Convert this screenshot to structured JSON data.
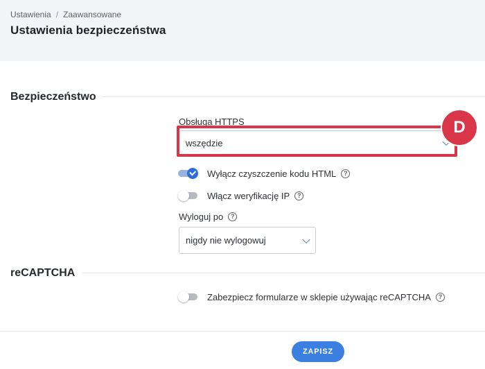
{
  "header": {
    "breadcrumb": [
      "Ustawienia",
      "Zaawansowane"
    ],
    "title": "Ustawienia bezpieczeństwa"
  },
  "security": {
    "title": "Bezpieczeństwo",
    "https": {
      "label": "Obsługa HTTPS",
      "value": "wszędzie"
    },
    "html_cleanup": {
      "label": "Wyłącz czyszczenie kodu HTML",
      "enabled": true
    },
    "ip_verification": {
      "label": "Włącz weryfikację IP",
      "enabled": false
    },
    "logout": {
      "label": "Wyloguj po",
      "value": "nigdy nie wylogowuj"
    }
  },
  "recaptcha": {
    "title": "reCAPTCHA",
    "protect_forms": {
      "label": "Zabezpiecz formularze w sklepie używając reCAPTCHA",
      "enabled": false
    }
  },
  "annotation": {
    "badge": "D",
    "color": "#d9364a"
  },
  "footer": {
    "save_label": "ZAPISZ"
  },
  "help_glyph": "?",
  "accent_color": "#3b7fe0"
}
